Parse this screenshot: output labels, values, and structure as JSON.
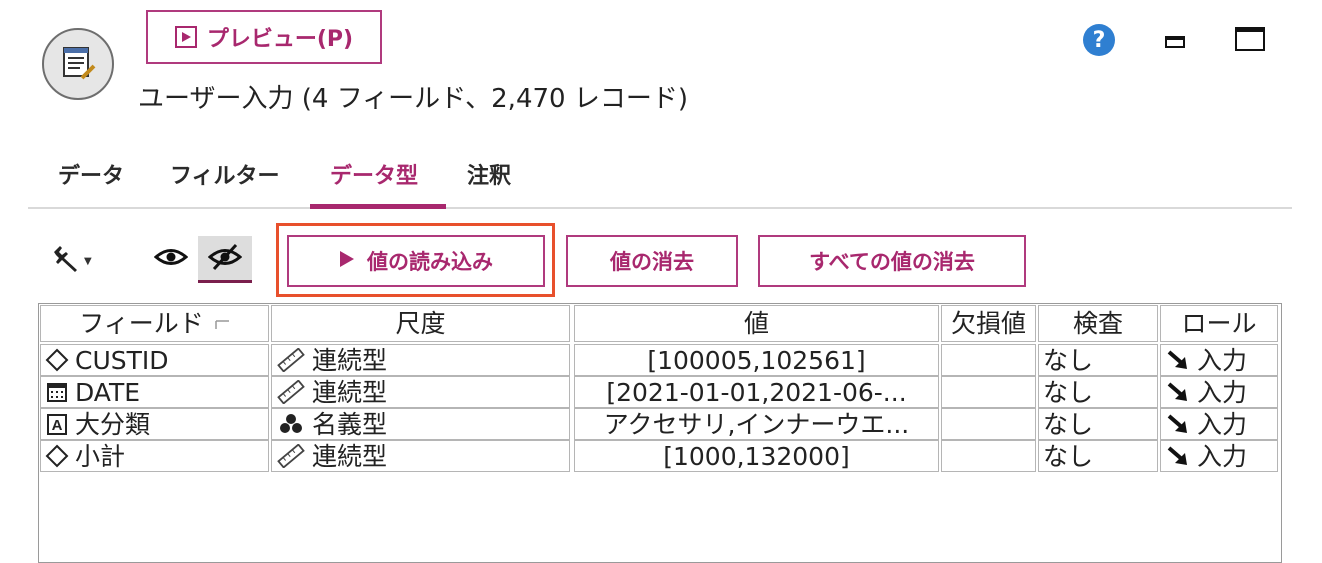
{
  "header": {
    "preview_label": "プレビュー(P)",
    "subtitle": "ユーザー入力 (4 フィールド、2,470 レコード)",
    "help_symbol": "?"
  },
  "tabs": [
    {
      "label": "データ",
      "active": false
    },
    {
      "label": "フィルター",
      "active": false
    },
    {
      "label": "データ型",
      "active": true
    },
    {
      "label": "注釈",
      "active": false
    }
  ],
  "toolbar": {
    "read_values_label": "値の読み込み",
    "clear_values_label": "値の消去",
    "clear_all_values_label": "すべての値の消去",
    "icons": [
      "wrench-icon",
      "eye-icon",
      "eye-off-icon"
    ]
  },
  "table": {
    "headers": [
      "フィールド",
      "尺度",
      "値",
      "欠損値",
      "検査",
      "ロール"
    ],
    "rows": [
      {
        "field": "CUSTID",
        "field_icon": "continuous-diamond-icon",
        "measure": "連続型",
        "measure_icon": "ruler-icon",
        "values": "[100005,102561]",
        "missing": "",
        "check": "なし",
        "role": "入力",
        "role_icon": "arrow-input-icon"
      },
      {
        "field": "DATE",
        "field_icon": "calendar-icon",
        "measure": "連続型",
        "measure_icon": "ruler-icon",
        "values": "[2021-01-01,2021-06-...",
        "missing": "",
        "check": "なし",
        "role": "入力",
        "role_icon": "arrow-input-icon"
      },
      {
        "field": "大分類",
        "field_icon": "string-a-icon",
        "measure": "名義型",
        "measure_icon": "nominal-dots-icon",
        "values": "アクセサリ,インナーウエ...",
        "missing": "",
        "check": "なし",
        "role": "入力",
        "role_icon": "arrow-input-icon"
      },
      {
        "field": "小計",
        "field_icon": "continuous-diamond-icon",
        "measure": "連続型",
        "measure_icon": "ruler-icon",
        "values": "[1000,132000]",
        "missing": "",
        "check": "なし",
        "role": "入力",
        "role_icon": "arrow-input-icon"
      }
    ]
  },
  "colors": {
    "accent": "#a8286e",
    "focus": "#e8502c",
    "help": "#2f7fd1"
  }
}
